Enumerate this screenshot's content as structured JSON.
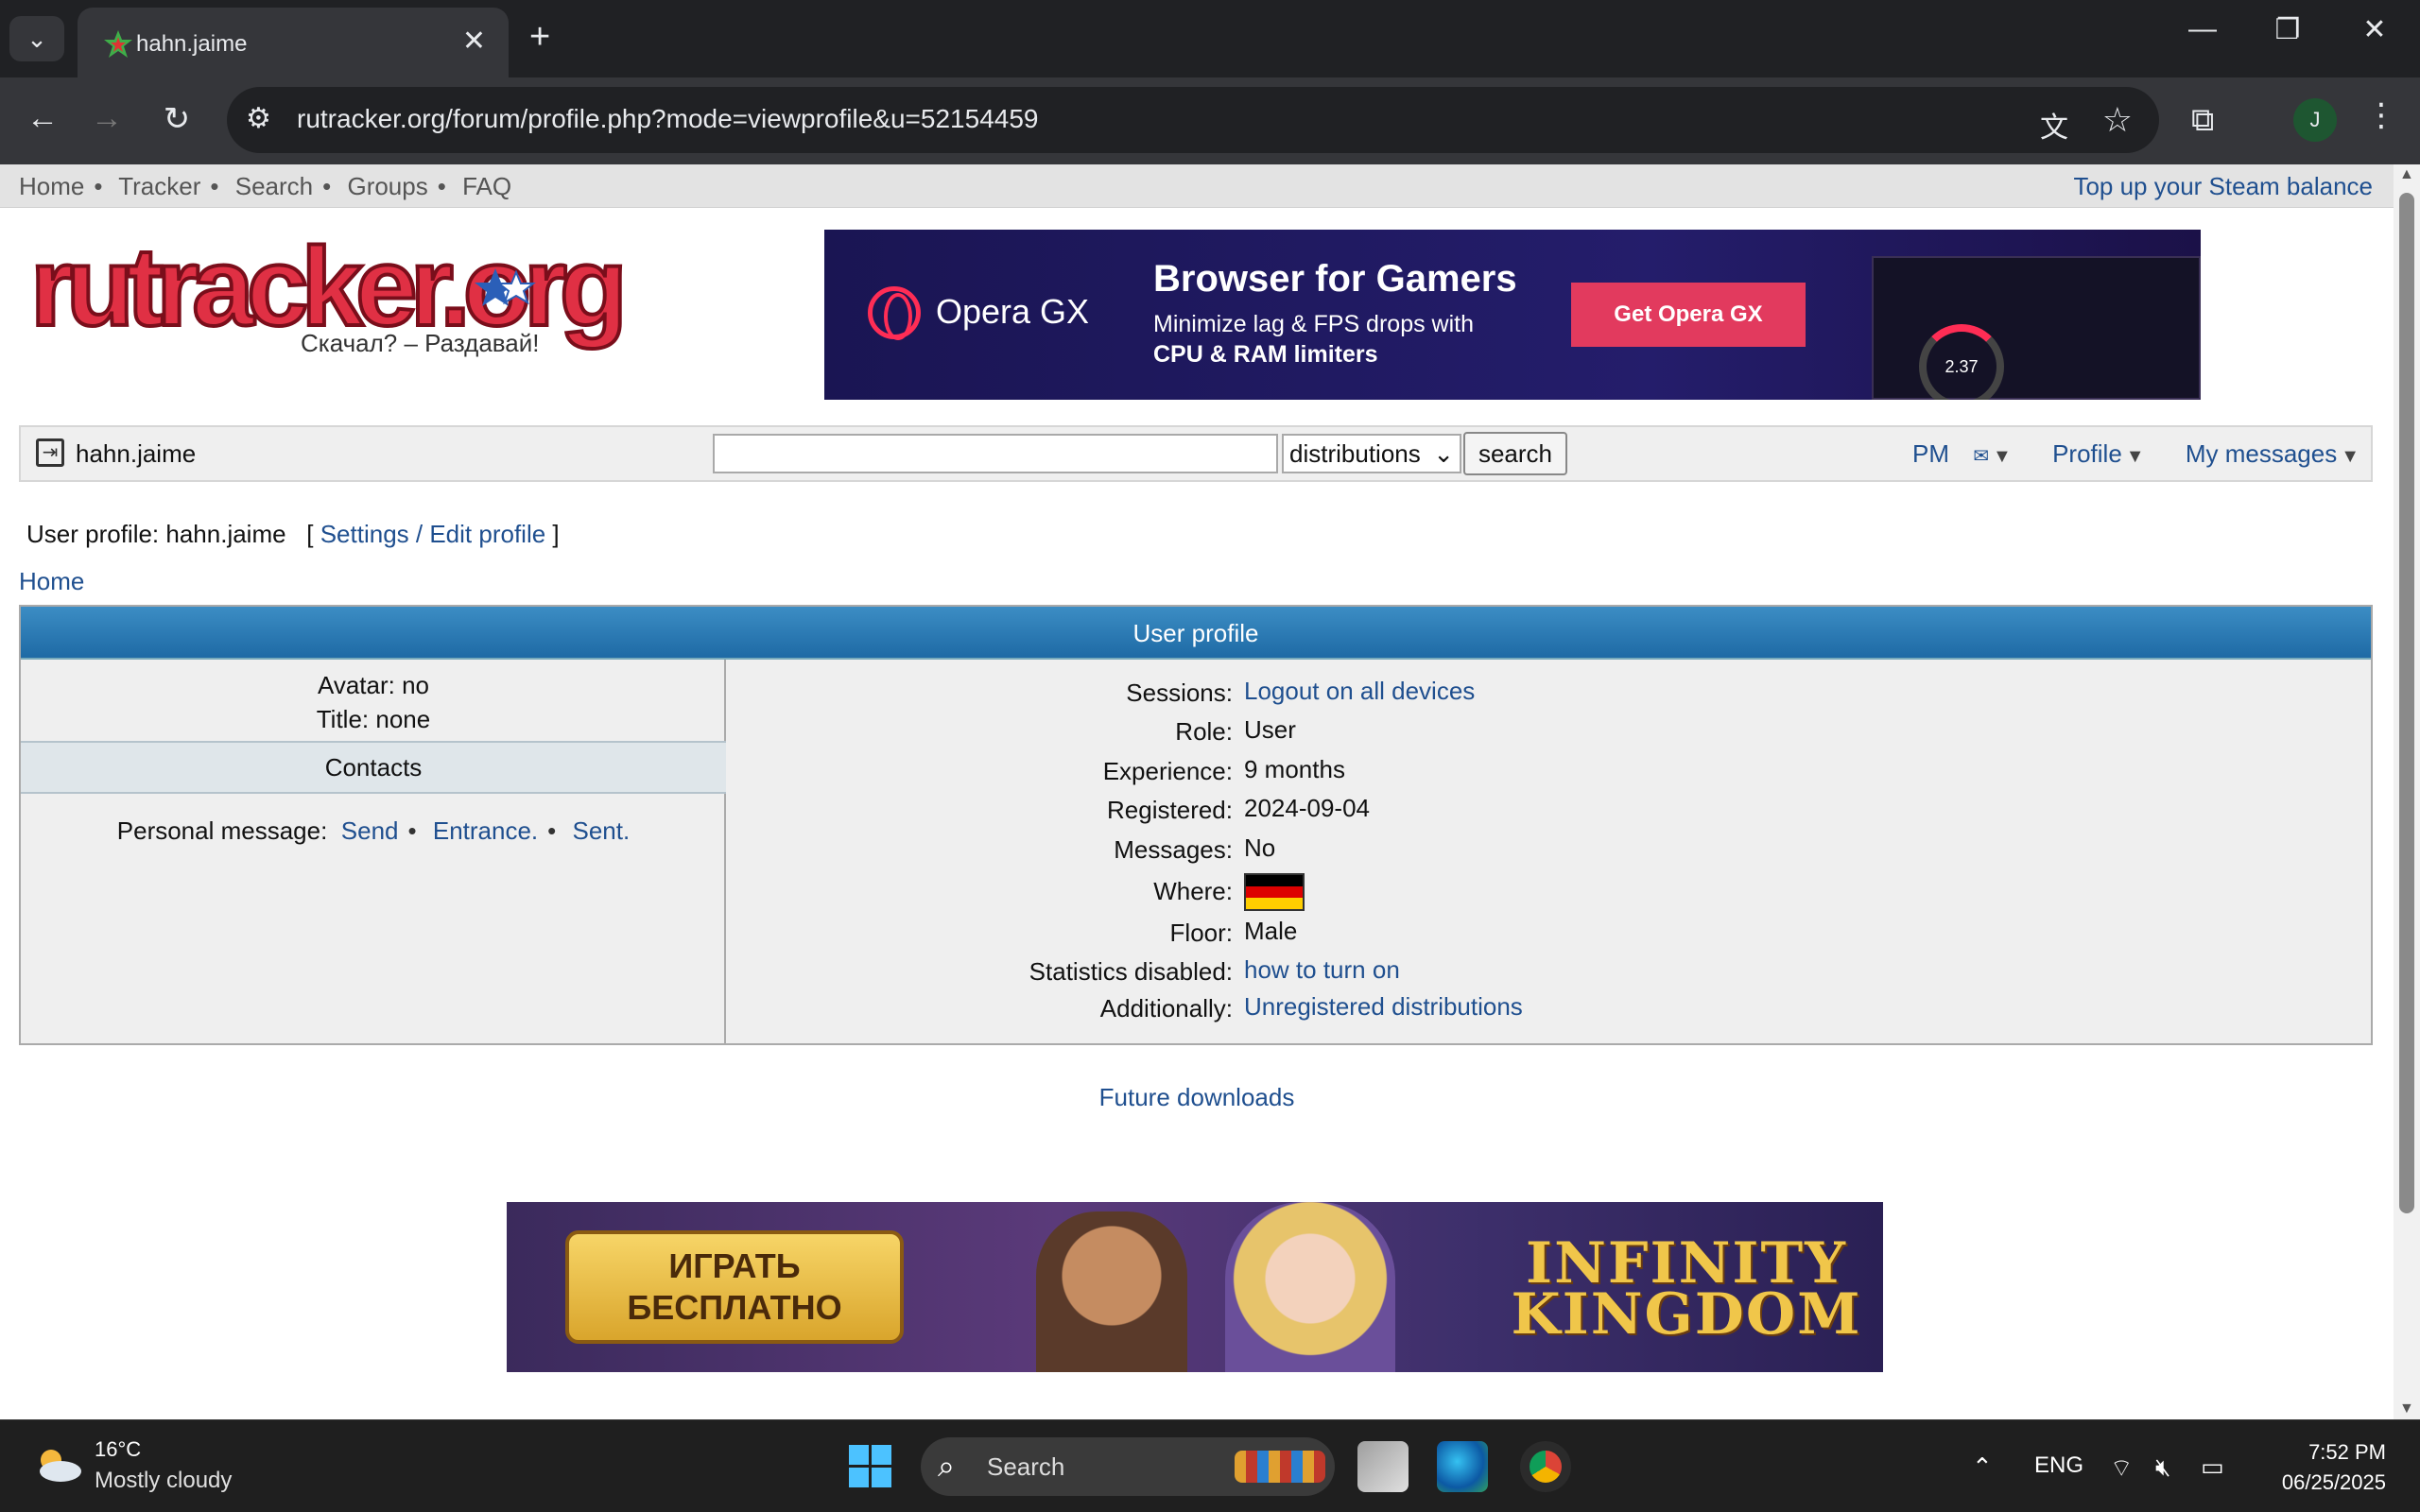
{
  "browser": {
    "tab_title": "hahn.jaime",
    "url": "rutracker.org/forum/profile.php?mode=viewprofile&u=52154459",
    "avatar_letter": "J"
  },
  "topnav": {
    "links": [
      "Home",
      "Tracker",
      "Search",
      "Groups",
      "FAQ"
    ],
    "steam": "Top up your Steam balance"
  },
  "logo": {
    "wordmark": "rutracker.org",
    "tagline": "Скачал? – Раздавай!"
  },
  "ad_top": {
    "brand": "Opera GX",
    "headline": "Browser for Gamers",
    "sub1": "Minimize lag & FPS drops with",
    "sub2": "CPU & RAM limiters",
    "cta": "Get Opera GX",
    "gauge_value": "2.37"
  },
  "userbar": {
    "username": "hahn.jaime",
    "search_placeholder": "",
    "search_scope": "distributions",
    "search_button": "search",
    "pm": "PM",
    "profile": "Profile",
    "my_messages": "My messages"
  },
  "profile_header": {
    "label": "User profile: hahn.jaime",
    "open_bracket": "[",
    "settings_link": "Settings / Edit profile",
    "close_bracket": "]"
  },
  "breadcrumb": "Home",
  "profile": {
    "table_title": "User profile",
    "avatar": "Avatar: no",
    "title": "Title: none",
    "contacts_header": "Contacts",
    "pm_label": "Personal message:",
    "pm_links": [
      "Send",
      "Entrance.",
      "Sent."
    ],
    "rows": [
      {
        "label": "Sessions:",
        "value": "Logout on all devices",
        "link": true
      },
      {
        "label": "Role:",
        "value": "User",
        "link": false
      },
      {
        "label": "Experience:",
        "value": "9 months",
        "link": false
      },
      {
        "label": "Registered:",
        "value": "2024-09-04",
        "link": false
      },
      {
        "label": "Messages:",
        "value": "No",
        "link": false
      },
      {
        "label": "Where:",
        "value": "",
        "link": false
      },
      {
        "label": "Floor:",
        "value": "Male",
        "link": false
      },
      {
        "label": "Statistics disabled:",
        "value": "how to turn on",
        "link": true
      },
      {
        "label": "Additionally:",
        "value": "Unregistered distributions",
        "link": true
      }
    ],
    "flag_colors": [
      "#000000",
      "#dd0000",
      "#ffce00"
    ]
  },
  "future_downloads": "Future downloads",
  "ad_bottom": {
    "play_text": "ИГРАТЬ БЕСПЛАТНО",
    "brand": "INFINITY KINGDOM"
  },
  "taskbar": {
    "temperature": "16°C",
    "weather": "Mostly cloudy",
    "search": "Search",
    "language": "ENG",
    "time": "7:52 PM",
    "date": "06/25/2025"
  },
  "colors": {
    "link": "#1f4f8f",
    "table_header": "#2a7ab8",
    "chrome_dark": "#202124"
  }
}
